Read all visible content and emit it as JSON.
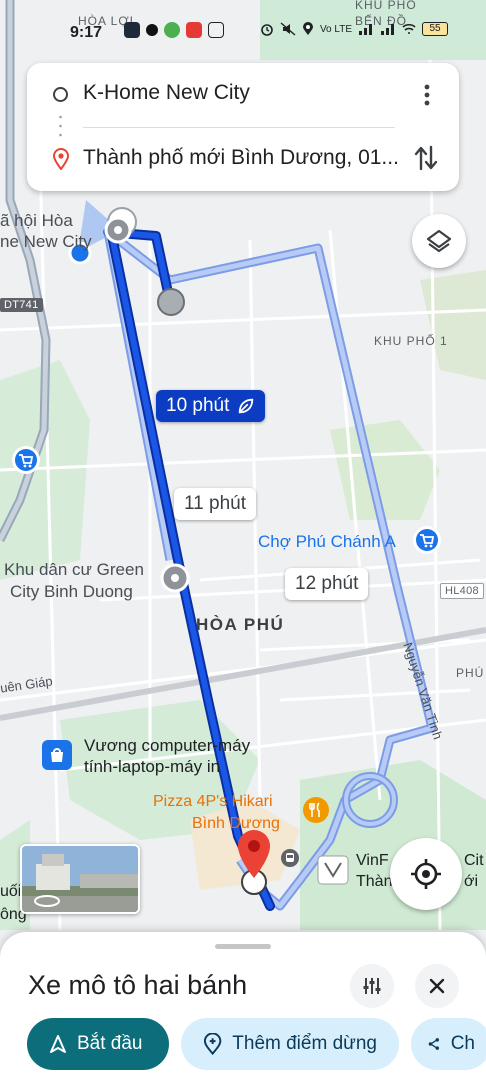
{
  "status_bar": {
    "time": "9:17",
    "battery": "55",
    "network": "Vo LTE"
  },
  "route_card": {
    "origin": "K-Home New City",
    "destination": "Thành phố mới Bình Dương, 01..."
  },
  "map": {
    "labels": {
      "hoa_loi": "HÒA LỢI",
      "khu_pho_ben": "KHU PHỐ",
      "ben_do": "BẾN ĐỒ",
      "xa_hoi_hoa": "ã hội Hòa",
      "ne_new_city": "ne New City",
      "khu_pho_1": "KHU PHỐ 1",
      "cho_phu_chanh": "Chợ Phú Chánh A",
      "khu_dan_cu_1": "Khu dân cư Green",
      "khu_dan_cu_2": "City Binh Duong",
      "hoa_phu": "HÒA PHÚ",
      "phu": "PHÚ",
      "nguyen_van_tinh": "Nguyễn Văn Tình",
      "an_giap": "uên Giáp",
      "vuong_1": "Vương computer-máy",
      "vuong_2": "tính-laptop-máy in",
      "pizza_1": "Pizza 4P's Hikari",
      "pizza_2": "Bình Dương",
      "vinf_1": "VinF",
      "vinf_2": "Thàn",
      "cit": "Cit",
      "moi": "ới",
      "uoi": "uối",
      "ong": "ông"
    },
    "road_shields": {
      "dt741": "DT741",
      "hl408": "HL408"
    },
    "eta_labels": {
      "main": "10 phút",
      "alt1": "11 phút",
      "alt2": "12 phút"
    }
  },
  "bottom_sheet": {
    "mode": "Xe mô tô hai bánh",
    "start_label": "Bắt đầu",
    "add_stop_label": "Thêm điểm dừng",
    "share_label": "Ch"
  },
  "colors": {
    "route_main": "#0b3cc1",
    "route_alt": "#a9c1f5",
    "accent_teal": "#0b6e7a",
    "chip_blue": "#d7eefc",
    "destination_red": "#ea4335"
  }
}
